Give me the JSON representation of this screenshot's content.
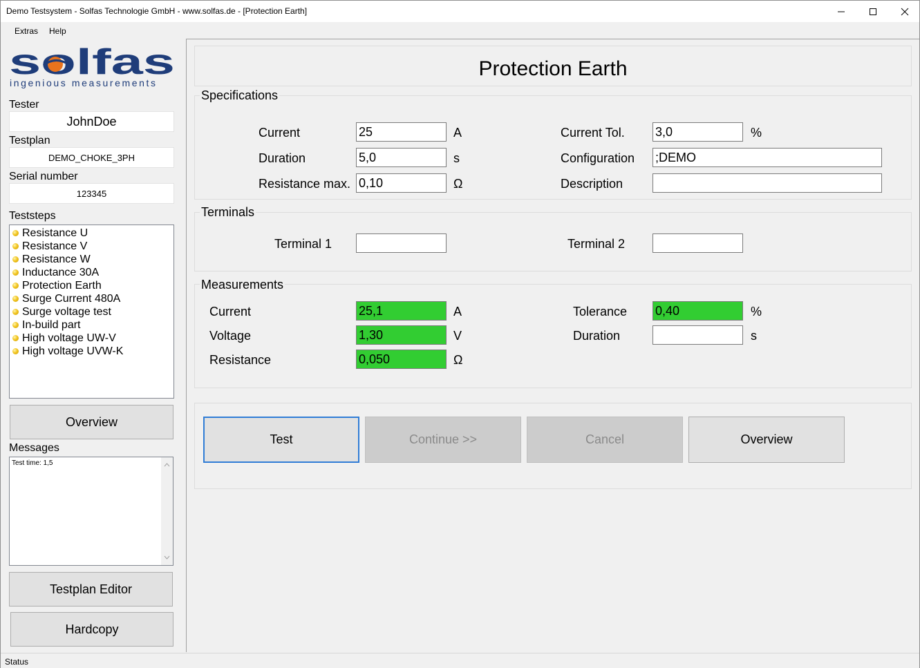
{
  "window": {
    "title": "Demo Testsystem - Solfas Technologie GmbH - www.solfas.de - [Protection Earth]",
    "menu": [
      "Extras",
      "Help"
    ]
  },
  "logo": {
    "brand": "solfas",
    "tagline": "ingenious measurements"
  },
  "sidebar": {
    "tester_label": "Tester",
    "tester_value": "JohnDoe",
    "testplan_label": "Testplan",
    "testplan_value": "DEMO_CHOKE_3PH",
    "serial_label": "Serial number",
    "serial_value": "123345",
    "teststeps_label": "Teststeps",
    "teststeps": [
      "Resistance U",
      "Resistance V",
      "Resistance W",
      "Inductance 30A",
      "Protection Earth",
      "Surge Current 480A",
      "Surge voltage test",
      "In-build part",
      "High voltage UW-V",
      "High voltage UVW-K"
    ],
    "overview_button": "Overview",
    "messages_label": "Messages",
    "messages_text": "Test time: 1,5",
    "testplan_editor_button": "Testplan Editor",
    "hardcopy_button": "Hardcopy"
  },
  "main": {
    "heading": "Protection Earth",
    "specifications": {
      "title": "Specifications",
      "current_label": "Current",
      "current_value": "25",
      "current_unit": "A",
      "duration_label": "Duration",
      "duration_value": "5,0",
      "duration_unit": "s",
      "resistance_label": "Resistance max.",
      "resistance_value": "0,10",
      "resistance_unit": "Ω",
      "current_tol_label": "Current Tol.",
      "current_tol_value": "3,0",
      "current_tol_unit": "%",
      "configuration_label": "Configuration",
      "configuration_value": ";DEMO",
      "description_label": "Description",
      "description_value": ""
    },
    "terminals": {
      "title": "Terminals",
      "terminal1_label": "Terminal 1",
      "terminal1_value": "",
      "terminal2_label": "Terminal 2",
      "terminal2_value": ""
    },
    "measurements": {
      "title": "Measurements",
      "current_label": "Current",
      "current_value": "25,1",
      "current_unit": "A",
      "voltage_label": "Voltage",
      "voltage_value": "1,30",
      "voltage_unit": "V",
      "resistance_label": "Resistance",
      "resistance_value": "0,050",
      "resistance_unit": "Ω",
      "tolerance_label": "Tolerance",
      "tolerance_value": "0,40",
      "tolerance_unit": "%",
      "duration_label": "Duration",
      "duration_value": "",
      "duration_unit": "s"
    },
    "buttons": {
      "test": "Test",
      "continue": "Continue >>",
      "cancel": "Cancel",
      "overview": "Overview"
    }
  },
  "colors": {
    "pass": "#32cd32",
    "focus": "#2f7cd6",
    "logo_blue": "#1f3d7a",
    "logo_orange": "#e8731d"
  },
  "status": "Status"
}
